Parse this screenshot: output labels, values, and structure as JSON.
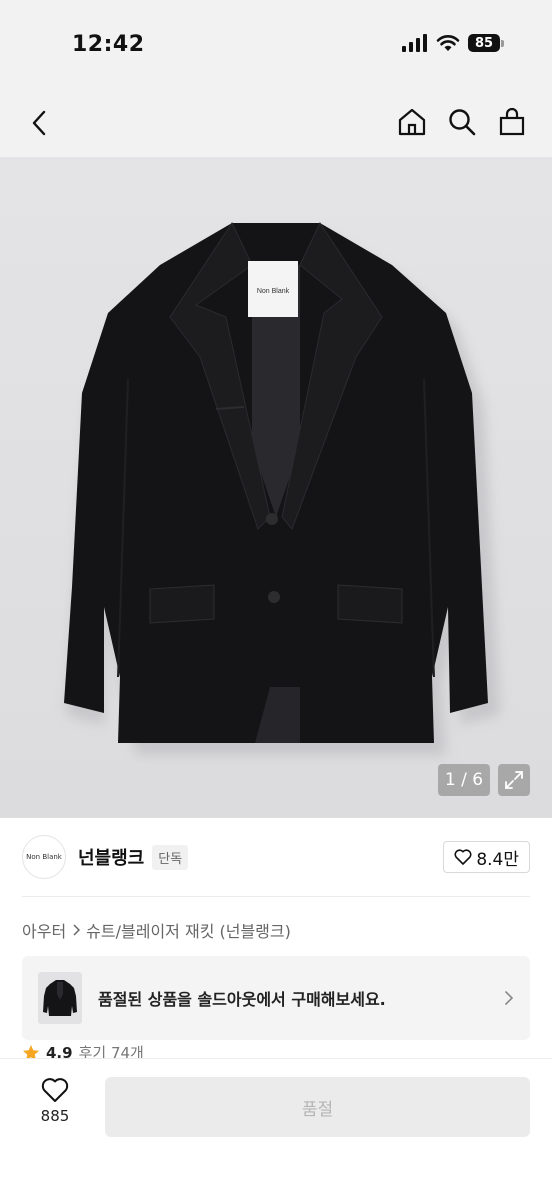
{
  "status_bar": {
    "time": "12:42",
    "battery": "85"
  },
  "nav": {
    "back_icon": "chevron-left-icon",
    "actions": [
      "home-icon",
      "search-icon",
      "bag-icon"
    ]
  },
  "gallery": {
    "counter": "1 / 6",
    "tag_text": "Non Blank"
  },
  "brand": {
    "logo_text": "Non Blank",
    "name": "넌블랭크",
    "badge": "단독",
    "likes": "8.4만"
  },
  "breadcrumb": {
    "category": "아우터",
    "subcategory": "슈트/블레이저 재킷 (넌블랭크)"
  },
  "soldout_banner": {
    "text": "품절된 상품을 솔드아웃에서 구매해보세요."
  },
  "rating": {
    "score": "4.9",
    "reviews": "후기 74개"
  },
  "bottom_bar": {
    "wish_count": "885",
    "buy_label": "품절"
  },
  "colors": {
    "accent_star": "#f5a623",
    "disabled_bg": "#ebebeb",
    "disabled_text": "#b5b5b5"
  }
}
